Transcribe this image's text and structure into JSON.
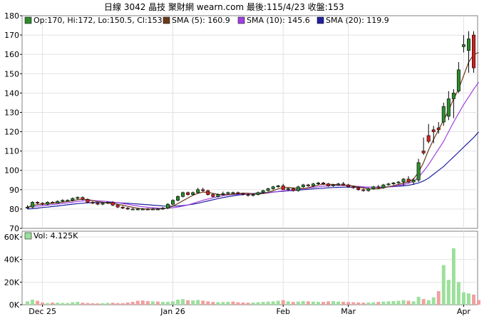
{
  "header": {
    "title": "日線  3042  晶技      聚財網 wearn.com     最後:115/4/23 收盤:153"
  },
  "legend": {
    "ohlc": "Op:170, Hi:172, Lo:150.5, Cl:153",
    "sma5": "SMA (5): 160.9",
    "sma10": "SMA (10): 145.6",
    "sma20": "SMA (20): 119.9",
    "vol": "Vol: 4.125K"
  },
  "colors": {
    "up": "#2e8b2e",
    "down": "#d42020",
    "sma5": "#6b3a1a",
    "sma10": "#a040e0",
    "sma20": "#2020a0",
    "vol_up": "#9be09b",
    "vol_down": "#f0a0a0",
    "grid": "#e2e2e2"
  },
  "chart_data": [
    {
      "type": "candlestick",
      "title": "日線  3042  晶技",
      "ylim": [
        70,
        180
      ],
      "y_ticks": [
        "70",
        "80",
        "90",
        "100",
        "110",
        "120",
        "130",
        "140",
        "150",
        "160",
        "170",
        "180"
      ],
      "x_ticks": [
        "Dec 25",
        "Jan 26",
        "Feb",
        "Mar",
        "Apr"
      ],
      "x_tick_index": [
        3,
        29,
        51,
        64,
        87
      ],
      "candles": [
        [
          80.5,
          82,
          80,
          81
        ],
        [
          81,
          84,
          80.5,
          83.5
        ],
        [
          83.5,
          84,
          82.5,
          83
        ],
        [
          83,
          83.5,
          82,
          82.5
        ],
        [
          82.5,
          84,
          82,
          83.5
        ],
        [
          83.5,
          84,
          83,
          83
        ],
        [
          83,
          84.5,
          83,
          84
        ],
        [
          84,
          85,
          83.5,
          84.5
        ],
        [
          84.5,
          85,
          84,
          84.5
        ],
        [
          84.5,
          86,
          84,
          85.5
        ],
        [
          85.5,
          86.5,
          85,
          86
        ],
        [
          86,
          86.5,
          84.5,
          85
        ],
        [
          85,
          85.5,
          83,
          83.5
        ],
        [
          83.5,
          84,
          82.5,
          83
        ],
        [
          83,
          83.5,
          82,
          82.5
        ],
        [
          82.5,
          83.5,
          82,
          83
        ],
        [
          83,
          84,
          82.5,
          83.5
        ],
        [
          83.5,
          84,
          81.5,
          82
        ],
        [
          82,
          82.5,
          80.5,
          81
        ],
        [
          81,
          81.5,
          80,
          80.5
        ],
        [
          80.5,
          81,
          79.5,
          80
        ],
        [
          80,
          80.5,
          79.5,
          80
        ],
        [
          80,
          80.5,
          79.5,
          80
        ],
        [
          80,
          80.5,
          79.5,
          80
        ],
        [
          80,
          80.5,
          79.5,
          79.8
        ],
        [
          79.8,
          80.5,
          79.5,
          80
        ],
        [
          80,
          80.5,
          79.5,
          80
        ],
        [
          80,
          81,
          79.5,
          80.5
        ],
        [
          80.5,
          83,
          80,
          82.5
        ],
        [
          82.5,
          85,
          82,
          84.5
        ],
        [
          84.5,
          87,
          84,
          86.5
        ],
        [
          86.5,
          89,
          86,
          88.5
        ],
        [
          88.5,
          89,
          87,
          87.5
        ],
        [
          87.5,
          89,
          87,
          88.5
        ],
        [
          88.5,
          91,
          88,
          90
        ],
        [
          90,
          91,
          89,
          89.5
        ],
        [
          89.5,
          90,
          87,
          87.5
        ],
        [
          87.5,
          88,
          86,
          86.5
        ],
        [
          86.5,
          88,
          86,
          87.5
        ],
        [
          87.5,
          89,
          87,
          88
        ],
        [
          88,
          89,
          87.5,
          88.5
        ],
        [
          88.5,
          89,
          88,
          88.5
        ],
        [
          88.5,
          89,
          87.5,
          88
        ],
        [
          88,
          88.5,
          87,
          87.5
        ],
        [
          87.5,
          88,
          86.5,
          87
        ],
        [
          87,
          88,
          86.5,
          87.5
        ],
        [
          87.5,
          89,
          87,
          88.5
        ],
        [
          88.5,
          90,
          88,
          89.5
        ],
        [
          89.5,
          91,
          89,
          90.5
        ],
        [
          90.5,
          92,
          90,
          91.5
        ],
        [
          91.5,
          92.5,
          91,
          92
        ],
        [
          92,
          93,
          91,
          90
        ],
        [
          90,
          91,
          89.5,
          90.5
        ],
        [
          90.5,
          91,
          89,
          89.5
        ],
        [
          89.5,
          92,
          89,
          91.5
        ],
        [
          91.5,
          93,
          91,
          92.5
        ],
        [
          92.5,
          93,
          91.5,
          92
        ],
        [
          92,
          93.5,
          91.5,
          93
        ],
        [
          93,
          94,
          92.5,
          93.5
        ],
        [
          93.5,
          94,
          92.5,
          93
        ],
        [
          93,
          93.5,
          91.5,
          92
        ],
        [
          92,
          93,
          91.5,
          92.5
        ],
        [
          92.5,
          93.5,
          92,
          93
        ],
        [
          93,
          94,
          92,
          92.5
        ],
        [
          92.5,
          93,
          91,
          91.5
        ],
        [
          91.5,
          92,
          90.5,
          91
        ],
        [
          91,
          91.5,
          89.5,
          90
        ],
        [
          90,
          90.5,
          89,
          89.5
        ],
        [
          89.5,
          91,
          89,
          90.5
        ],
        [
          90.5,
          92,
          90,
          91.5
        ],
        [
          91.5,
          92.5,
          90.5,
          91
        ],
        [
          91,
          93,
          90.5,
          92.5
        ],
        [
          92.5,
          93.5,
          92,
          93
        ],
        [
          93,
          94,
          92.5,
          93.5
        ],
        [
          93.5,
          94.5,
          93,
          94
        ],
        [
          94,
          96,
          92,
          95.5
        ],
        [
          95.5,
          97,
          93.5,
          94
        ],
        [
          94,
          96,
          92.5,
          95
        ],
        [
          95,
          106,
          94,
          104
        ],
        [
          110,
          117,
          108,
          109
        ],
        [
          118,
          124,
          114,
          115
        ],
        [
          121,
          123,
          114,
          120
        ],
        [
          122,
          125,
          119,
          121
        ],
        [
          125,
          135,
          123,
          133
        ],
        [
          128,
          141,
          126,
          137
        ],
        [
          137,
          142,
          127,
          140
        ],
        [
          141,
          156,
          140,
          152
        ],
        [
          164,
          170,
          161,
          165
        ],
        [
          162,
          172,
          150.5,
          168
        ],
        [
          170,
          172,
          150.5,
          153
        ]
      ],
      "sma5": [
        81,
        81.8,
        82.3,
        82.6,
        82.7,
        83,
        83.3,
        83.6,
        83.9,
        84.3,
        84.8,
        85.1,
        84.9,
        84.4,
        83.8,
        83.5,
        83.1,
        82.8,
        82.4,
        82,
        81.4,
        80.9,
        80.4,
        80.1,
        80,
        80,
        80,
        80.1,
        80.6,
        81.5,
        82.8,
        84.3,
        85.7,
        87.1,
        88.1,
        88.8,
        88.6,
        88.1,
        87.6,
        87.4,
        87.5,
        87.7,
        88,
        88.2,
        88.2,
        87.9,
        87.8,
        88,
        88.6,
        89.5,
        90.4,
        91.1,
        91.2,
        90.9,
        90.7,
        90.6,
        91,
        91.7,
        92.4,
        92.8,
        92.8,
        92.7,
        92.5,
        92.4,
        92.3,
        91.9,
        91.4,
        90.9,
        90.5,
        90.4,
        90.5,
        91,
        91.5,
        92.1,
        92.7,
        93.4,
        94.1,
        95.5,
        99,
        104,
        110.5,
        116,
        121,
        126,
        131,
        137,
        142,
        149,
        156,
        160,
        160.9
      ],
      "sma10": [
        81,
        81.2,
        81.5,
        81.8,
        82,
        82.3,
        82.6,
        82.9,
        83.2,
        83.5,
        83.9,
        84.2,
        84.4,
        84.4,
        84.3,
        84.1,
        83.9,
        83.6,
        83.3,
        82.9,
        82.5,
        82,
        81.6,
        81.2,
        80.9,
        80.7,
        80.5,
        80.4,
        80.5,
        80.7,
        81,
        81.5,
        82.1,
        82.9,
        83.7,
        84.5,
        85.2,
        85.8,
        86.4,
        86.9,
        87.3,
        87.5,
        87.6,
        87.7,
        87.7,
        87.7,
        87.8,
        88,
        88.3,
        88.7,
        89.1,
        89.4,
        89.6,
        89.9,
        90.2,
        90.5,
        90.8,
        91.2,
        91.5,
        91.8,
        92,
        92.2,
        92.2,
        92.2,
        92.1,
        91.9,
        91.7,
        91.5,
        91.3,
        91.2,
        91.2,
        91.3,
        91.5,
        91.8,
        92.2,
        92.7,
        93.3,
        94.3,
        96.5,
        99.5,
        103,
        107,
        111,
        115,
        120,
        125,
        129.5,
        134,
        138,
        142,
        145.6
      ],
      "sma20": [
        80,
        80.2,
        80.5,
        80.8,
        81,
        81.3,
        81.6,
        81.9,
        82.2,
        82.5,
        82.8,
        83,
        83.2,
        83.3,
        83.4,
        83.4,
        83.4,
        83.3,
        83.2,
        83.1,
        83,
        82.8,
        82.6,
        82.4,
        82.2,
        82,
        81.8,
        81.6,
        81.5,
        81.5,
        81.6,
        81.8,
        82.1,
        82.5,
        83,
        83.6,
        84.2,
        84.8,
        85.4,
        85.9,
        86.4,
        86.8,
        87.2,
        87.5,
        87.8,
        88,
        88.2,
        88.4,
        88.6,
        88.8,
        89,
        89.2,
        89.4,
        89.6,
        89.8,
        90,
        90.2,
        90.4,
        90.6,
        90.8,
        91,
        91.1,
        91.2,
        91.3,
        91.3,
        91.3,
        91.3,
        91.3,
        91.3,
        91.3,
        91.3,
        91.4,
        91.5,
        91.6,
        91.8,
        92,
        92.3,
        92.8,
        93.5,
        94.5,
        96,
        98,
        100,
        102,
        104.5,
        107,
        109.5,
        112,
        114.5,
        117,
        119.9
      ]
    },
    {
      "type": "bar",
      "title": "Vol: 4.125K",
      "ylim": [
        0,
        60000
      ],
      "y_ticks": [
        "0K",
        "20K",
        "40K",
        "60K"
      ],
      "values": [
        3000,
        4500,
        3500,
        2000,
        1500,
        2000,
        1800,
        1600,
        1500,
        2200,
        2500,
        1800,
        1500,
        1300,
        1200,
        1400,
        1600,
        1800,
        1500,
        1400,
        2000,
        2500,
        3500,
        3800,
        3200,
        3000,
        2800,
        2500,
        2600,
        3000,
        4500,
        5000,
        4000,
        3800,
        4200,
        3600,
        3000,
        2500,
        2200,
        2400,
        2600,
        2800,
        2200,
        2000,
        1800,
        2000,
        2200,
        2500,
        2800,
        3000,
        3500,
        4000,
        3000,
        2500,
        2800,
        3200,
        3000,
        2800,
        2600,
        2500,
        3000,
        3200,
        2800,
        2600,
        2400,
        2200,
        2000,
        1800,
        2000,
        2200,
        2500,
        2800,
        3000,
        3200,
        3500,
        4000,
        3500,
        3000,
        7000,
        5000,
        4000,
        6500,
        12000,
        35000,
        22000,
        50000,
        20000,
        11000,
        10000,
        9000,
        4125
      ],
      "up": [
        1,
        1,
        0,
        0,
        1,
        0,
        1,
        1,
        1,
        1,
        1,
        0,
        0,
        0,
        0,
        1,
        1,
        0,
        0,
        0,
        0,
        0,
        0,
        0,
        0,
        1,
        0,
        1,
        1,
        1,
        1,
        1,
        0,
        1,
        1,
        0,
        0,
        0,
        1,
        1,
        1,
        0,
        0,
        0,
        0,
        1,
        1,
        1,
        1,
        1,
        1,
        0,
        1,
        0,
        1,
        1,
        0,
        1,
        1,
        0,
        0,
        1,
        1,
        0,
        0,
        0,
        0,
        0,
        1,
        1,
        0,
        1,
        1,
        1,
        1,
        1,
        0,
        1,
        1,
        0,
        1,
        1,
        0,
        1,
        1,
        1,
        1,
        1,
        1,
        0,
        0
      ]
    }
  ]
}
